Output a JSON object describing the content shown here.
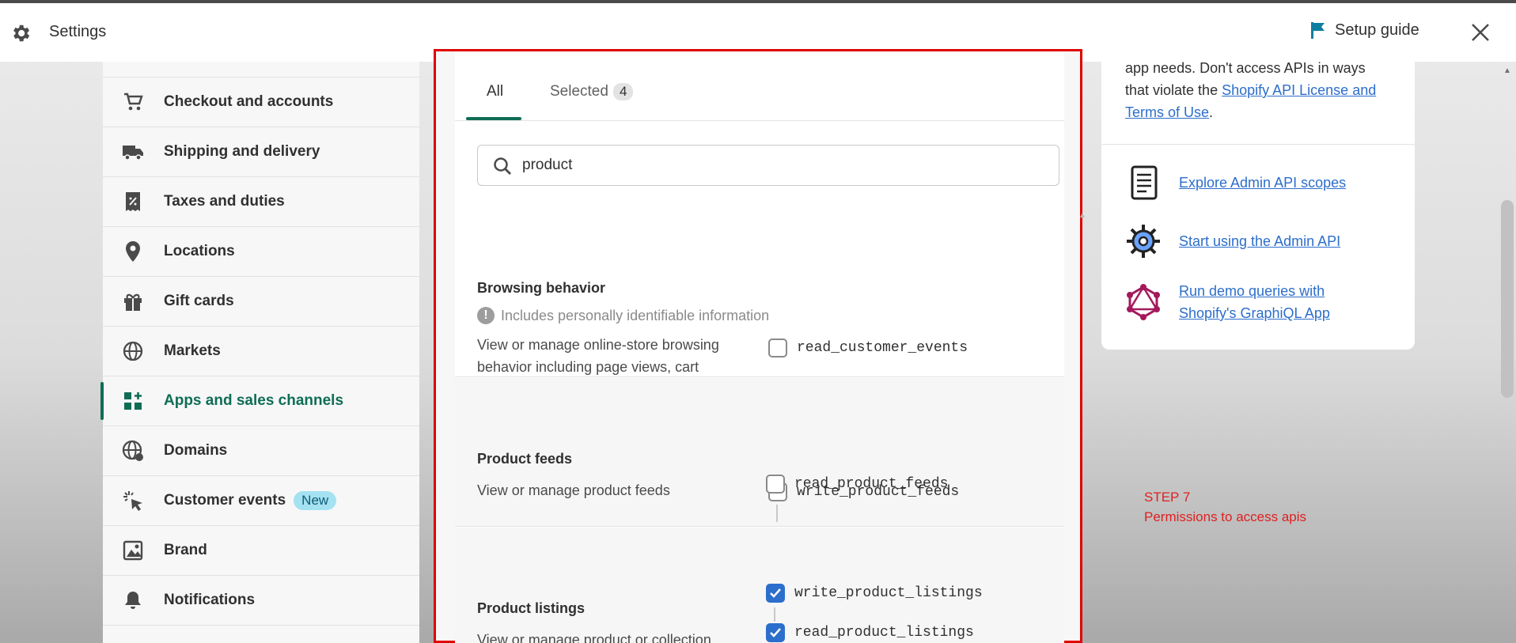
{
  "header": {
    "title": "Settings",
    "setup_guide": "Setup guide"
  },
  "sidebar": {
    "items": [
      {
        "label": "Checkout and accounts",
        "icon": "cart-icon"
      },
      {
        "label": "Shipping and delivery",
        "icon": "truck-icon"
      },
      {
        "label": "Taxes and duties",
        "icon": "receipt-icon"
      },
      {
        "label": "Locations",
        "icon": "location-pin-icon"
      },
      {
        "label": "Gift cards",
        "icon": "gift-icon"
      },
      {
        "label": "Markets",
        "icon": "globe-icon"
      },
      {
        "label": "Apps and sales channels",
        "icon": "apps-icon",
        "active": true
      },
      {
        "label": "Domains",
        "icon": "domain-globe-icon"
      },
      {
        "label": "Customer events",
        "icon": "cursor-click-icon",
        "badge": "New"
      },
      {
        "label": "Brand",
        "icon": "brand-icon"
      },
      {
        "label": "Notifications",
        "icon": "bell-icon"
      }
    ]
  },
  "main": {
    "tabs": {
      "all": "All",
      "selected": "Selected",
      "selected_count": "4"
    },
    "search": {
      "value": "product"
    },
    "sections": [
      {
        "title": "Browsing behavior",
        "pii_note": "Includes personally identifiable information",
        "description": "View or manage online-store browsing behavior including page views, cart updates, product views and searches",
        "scopes": [
          {
            "name": "read_customer_events",
            "checked": false
          }
        ]
      },
      {
        "title": "Product feeds",
        "description": "View or manage product feeds",
        "scopes": [
          {
            "name": "write_product_feeds",
            "checked": false
          },
          {
            "name": "read_product_feeds",
            "checked": false
          }
        ]
      },
      {
        "title": "Product listings",
        "description": "View or manage product or collection listings",
        "scopes": [
          {
            "name": "write_product_listings",
            "checked": true
          },
          {
            "name": "read_product_listings",
            "checked": true
          }
        ]
      }
    ]
  },
  "right_panel": {
    "note_prefix": "app needs. Don't access APIs in ways that violate the ",
    "note_link": "Shopify API License and Terms of Use",
    "note_suffix": ".",
    "resources": [
      {
        "label": "Explore Admin API scopes",
        "icon": "document-scroll-icon"
      },
      {
        "label": "Start using the Admin API",
        "icon": "cog-icon"
      },
      {
        "label": "Run demo queries with Shopify's GraphiQL App",
        "icon": "graphql-icon"
      }
    ]
  },
  "overlay": {
    "step": "STEP 7",
    "caption": "Permissions to access apis"
  },
  "colors": {
    "accent": "#0f6d55",
    "link": "#2c6ecb",
    "highlight_border": "#e00000",
    "annotation": "#e02020"
  }
}
